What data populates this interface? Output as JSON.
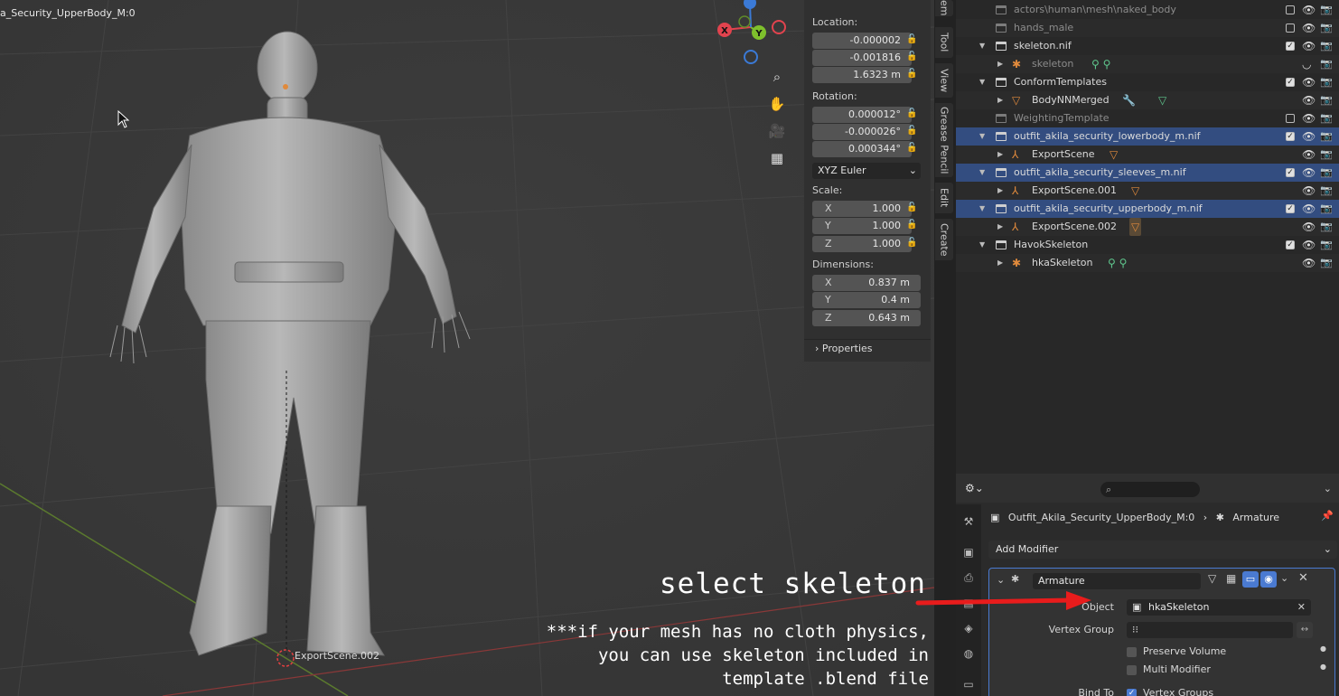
{
  "viewport": {
    "object_label": "a_Security_UpperBody_M:0",
    "origin_label": "ExportScene.002",
    "gizmo": {
      "x": "X",
      "y": "Y",
      "z": "Z"
    }
  },
  "npanel": {
    "location_label": "Location:",
    "location": [
      "-0.000002",
      "-0.001816",
      "1.6323 m"
    ],
    "rotation_label": "Rotation:",
    "rotation": [
      "0.000012°",
      "-0.000026°",
      "0.000344°"
    ],
    "rotation_mode": "XYZ Euler",
    "scale_label": "Scale:",
    "scale": [
      {
        "axis": "X",
        "value": "1.000"
      },
      {
        "axis": "Y",
        "value": "1.000"
      },
      {
        "axis": "Z",
        "value": "1.000"
      }
    ],
    "dimensions_label": "Dimensions:",
    "dimensions": [
      {
        "axis": "X",
        "value": "0.837 m"
      },
      {
        "axis": "Y",
        "value": "0.4 m"
      },
      {
        "axis": "Z",
        "value": "0.643 m"
      }
    ],
    "properties_label": "Properties"
  },
  "vtabs": [
    "em",
    "Tool",
    "View",
    "Grease Pencil",
    "Edit",
    "Create"
  ],
  "outliner": {
    "rows": [
      {
        "name": "actors\\human\\mesh\\naked_body"
      },
      {
        "name": "hands_male"
      },
      {
        "name": "skeleton.nif"
      },
      {
        "name": "skeleton"
      },
      {
        "name": "ConformTemplates"
      },
      {
        "name": "BodyNNMerged"
      },
      {
        "name": "WeightingTemplate"
      },
      {
        "name": "outfit_akila_security_lowerbody_m.nif"
      },
      {
        "name": "ExportScene"
      },
      {
        "name": "outfit_akila_security_sleeves_m.nif"
      },
      {
        "name": "ExportScene.001"
      },
      {
        "name": "outfit_akila_security_upperbody_m.nif"
      },
      {
        "name": "ExportScene.002"
      },
      {
        "name": "HavokSkeleton"
      },
      {
        "name": "hkaSkeleton"
      }
    ]
  },
  "properties": {
    "breadcrumb_object": "Outfit_Akila_Security_UpperBody_M:0",
    "breadcrumb_modifier": "Armature",
    "add_modifier": "Add Modifier",
    "modifier_name": "Armature",
    "object_label": "Object",
    "object_value": "hkaSkeleton",
    "vertex_group_label": "Vertex Group",
    "preserve_volume": "Preserve Volume",
    "multi_modifier": "Multi Modifier",
    "bind_to_label": "Bind To",
    "vertex_groups": "Vertex Groups"
  },
  "annotation": {
    "title": "select skeleton",
    "note": "***if your mesh has no cloth physics,\nyou can use skeleton included in\ntemplate .blend file",
    "arrow_color": "#e81c1c"
  },
  "colors": {
    "selection": "#334d80",
    "accent": "#4a7ad1",
    "bone": "#e08a3c",
    "x_axis": "#e2434e",
    "y_axis": "#7ec02c",
    "z_axis": "#3b7ad6"
  }
}
